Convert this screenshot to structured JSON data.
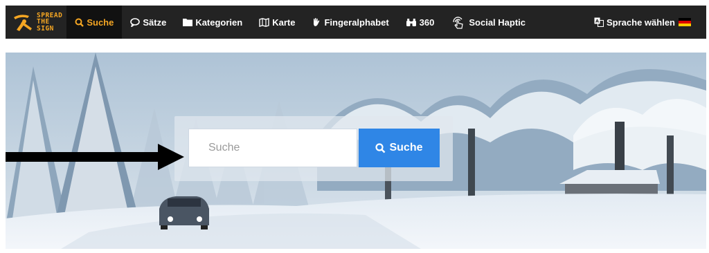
{
  "brand": {
    "lines": [
      "SPREAD",
      "THE",
      "SIGN"
    ],
    "accent": "#f5a623"
  },
  "nav": {
    "items": [
      {
        "label": "Suche",
        "icon": "search-icon",
        "active": true
      },
      {
        "label": "Sätze",
        "icon": "speech-bubble-icon"
      },
      {
        "label": "Kategorien",
        "icon": "folder-icon"
      },
      {
        "label": "Karte",
        "icon": "map-icon"
      },
      {
        "label": "Fingeralphabet",
        "icon": "hand-icon"
      },
      {
        "label": "360",
        "icon": "binoculars-icon"
      },
      {
        "label": "Social Haptic",
        "icon": "touch-icon"
      }
    ],
    "language": {
      "label": "Sprache wählen",
      "icon": "translate-icon",
      "flag": "german-flag-icon"
    }
  },
  "hero": {
    "search": {
      "placeholder": "Suche",
      "button_label": "Suche"
    }
  },
  "colors": {
    "navbar": "#232323",
    "button": "#2f86e6"
  }
}
